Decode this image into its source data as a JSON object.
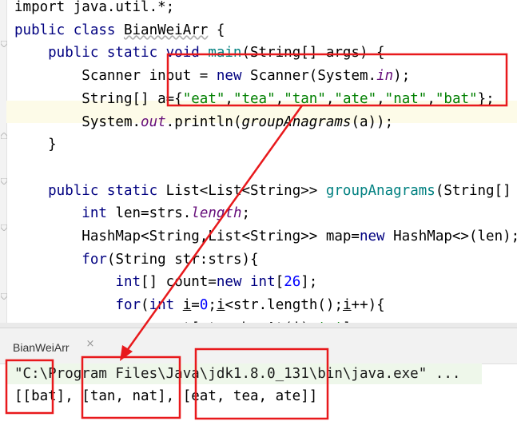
{
  "editor": {
    "lines": [
      {
        "parts": [
          {
            "t": "import java.util.*;",
            "c": ""
          }
        ]
      },
      {
        "parts": [
          {
            "t": "public class ",
            "c": "kw"
          },
          {
            "t": "BianWeiArr",
            "c": "squiggle"
          },
          {
            "t": " {",
            "c": ""
          }
        ]
      },
      {
        "parts": [
          {
            "t": "    public static void ",
            "c": "kw"
          },
          {
            "t": "main",
            "c": "fn"
          },
          {
            "t": "(String[] args) {",
            "c": ""
          }
        ]
      },
      {
        "parts": [
          {
            "t": "        Scanner input = ",
            "c": ""
          },
          {
            "t": "new ",
            "c": "kw"
          },
          {
            "t": "Scanner(System.",
            "c": ""
          },
          {
            "t": "in",
            "c": "fld"
          },
          {
            "t": ");",
            "c": ""
          }
        ]
      },
      {
        "parts": [
          {
            "t": "        String[] a={",
            "c": ""
          },
          {
            "t": "\"eat\"",
            "c": "str"
          },
          {
            "t": ",",
            "c": ""
          },
          {
            "t": "\"tea\"",
            "c": "str"
          },
          {
            "t": ",",
            "c": ""
          },
          {
            "t": "\"tan\"",
            "c": "str"
          },
          {
            "t": ",",
            "c": ""
          },
          {
            "t": "\"ate\"",
            "c": "str"
          },
          {
            "t": ",",
            "c": ""
          },
          {
            "t": "\"nat\"",
            "c": "str"
          },
          {
            "t": ",",
            "c": ""
          },
          {
            "t": "\"bat\"",
            "c": "str"
          },
          {
            "t": "};",
            "c": ""
          }
        ]
      },
      {
        "parts": [
          {
            "t": "        System.",
            "c": ""
          },
          {
            "t": "out",
            "c": "fld"
          },
          {
            "t": ".println(",
            "c": ""
          },
          {
            "t": "groupAnagrams",
            "c": "it"
          },
          {
            "t": "(a));",
            "c": ""
          }
        ]
      },
      {
        "parts": [
          {
            "t": "    }",
            "c": ""
          }
        ]
      },
      {
        "parts": [
          {
            "t": "",
            "c": ""
          }
        ]
      },
      {
        "parts": [
          {
            "t": "    public static ",
            "c": "kw"
          },
          {
            "t": "List<List<String>> ",
            "c": ""
          },
          {
            "t": "groupAnagrams",
            "c": "fn"
          },
          {
            "t": "(String[] strs) {",
            "c": ""
          }
        ]
      },
      {
        "parts": [
          {
            "t": "        ",
            "c": ""
          },
          {
            "t": "int ",
            "c": "kw"
          },
          {
            "t": "len=strs.",
            "c": ""
          },
          {
            "t": "length",
            "c": "fld"
          },
          {
            "t": ";",
            "c": ""
          }
        ]
      },
      {
        "parts": [
          {
            "t": "        HashMap<String,List<String>> map=",
            "c": ""
          },
          {
            "t": "new ",
            "c": "kw"
          },
          {
            "t": "HashMap<>(len);",
            "c": ""
          }
        ]
      },
      {
        "parts": [
          {
            "t": "        ",
            "c": ""
          },
          {
            "t": "for",
            "c": "kw"
          },
          {
            "t": "(String str:strs){",
            "c": ""
          }
        ]
      },
      {
        "parts": [
          {
            "t": "            ",
            "c": ""
          },
          {
            "t": "int",
            "c": "kw"
          },
          {
            "t": "[] count=",
            "c": ""
          },
          {
            "t": "new int",
            "c": "kw"
          },
          {
            "t": "[",
            "c": ""
          },
          {
            "t": "26",
            "c": "num"
          },
          {
            "t": "];",
            "c": ""
          }
        ]
      },
      {
        "parts": [
          {
            "t": "            ",
            "c": ""
          },
          {
            "t": "for",
            "c": "kw"
          },
          {
            "t": "(",
            "c": ""
          },
          {
            "t": "int ",
            "c": "kw"
          },
          {
            "t": "i",
            "c": "ul"
          },
          {
            "t": "=",
            "c": ""
          },
          {
            "t": "0",
            "c": "num"
          },
          {
            "t": ";",
            "c": ""
          },
          {
            "t": "i",
            "c": "ul"
          },
          {
            "t": "<str.length();",
            "c": ""
          },
          {
            "t": "i",
            "c": "ul"
          },
          {
            "t": "++){",
            "c": ""
          }
        ]
      },
      {
        "parts": [
          {
            "t": "                count[str.charAt(",
            "c": ""
          },
          {
            "t": "i",
            "c": "ul"
          },
          {
            "t": ")-",
            "c": ""
          },
          {
            "t": "'a'",
            "c": "str"
          },
          {
            "t": "]++;",
            "c": ""
          }
        ]
      }
    ]
  },
  "run_panel": {
    "tab_label": "BianWeiArr",
    "tab_close": "×",
    "command_line": "\"C:\\Program Files\\Java\\jdk1.8.0_131\\bin\\java.exe\" ...",
    "output_line": "[[bat], [tan, nat], [eat, tea, ate]]"
  },
  "annotation": {
    "color": "#e8191c"
  }
}
